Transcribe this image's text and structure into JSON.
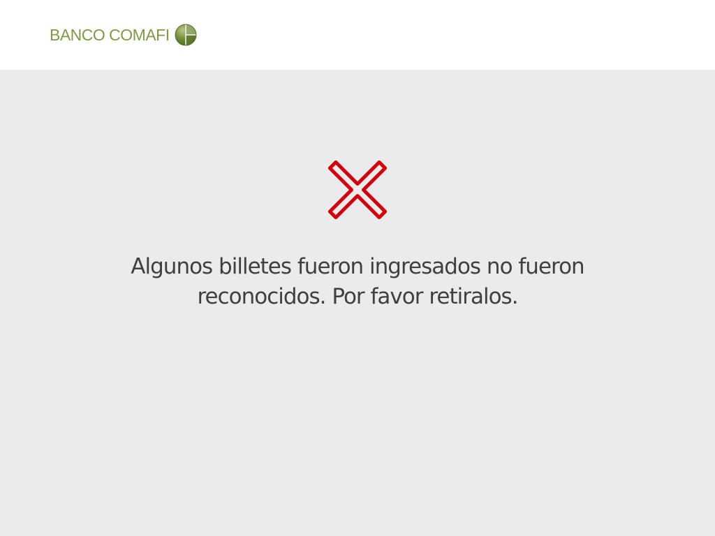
{
  "header": {
    "brand_name": "BANCO COMAFI",
    "logo_icon": "globe-logo-icon"
  },
  "status": {
    "icon": "close-icon",
    "message_line_1": "Algunos billetes fueron ingresados no fueron",
    "message_line_2": "reconocidos. Por favor retiralos."
  },
  "colors": {
    "header_background": "#ffffff",
    "page_background": "#ebebeb",
    "brand_green": "#7f9a43",
    "error_red": "#d4000b",
    "message_text": "#3f3f3f"
  }
}
